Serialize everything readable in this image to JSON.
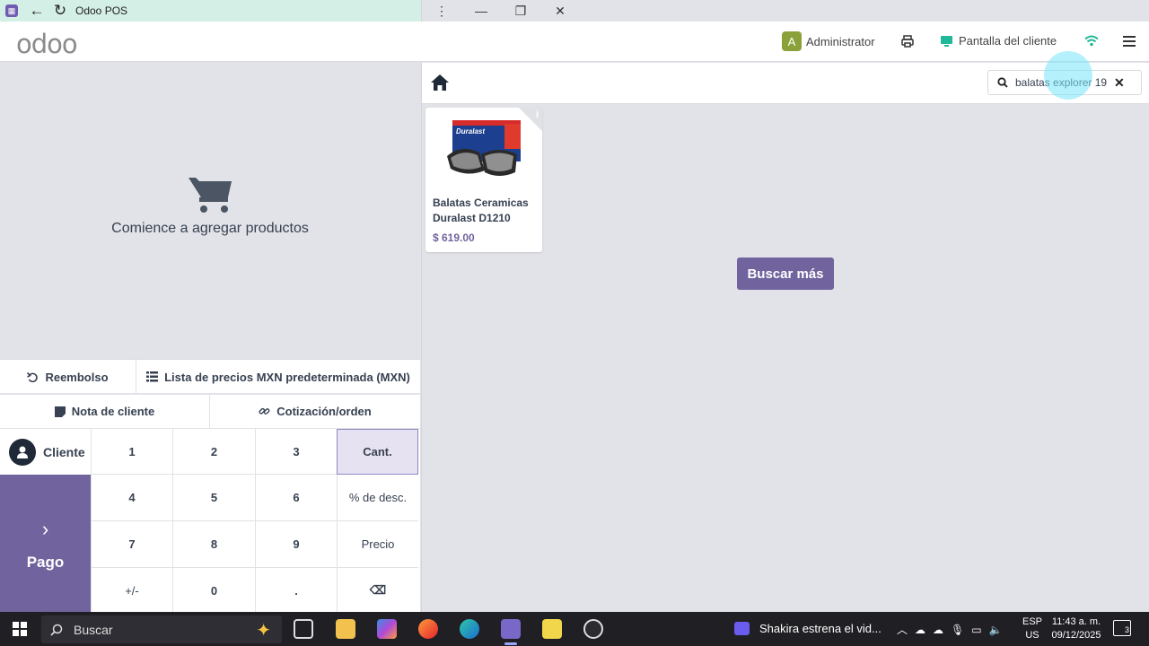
{
  "window": {
    "title": "Odoo POS",
    "back_glyph": "←",
    "reload_glyph": "↻",
    "kebab_glyph": "⋮",
    "minimize_glyph": "—",
    "restore_glyph": "❐",
    "close_glyph": "✕"
  },
  "header": {
    "logo": "odoo",
    "user_initial": "A",
    "user_name": "Administrator",
    "customer_display": "Pantalla del cliente",
    "colors": {
      "accent": "#71639e",
      "wifi": "#21b799",
      "display_icon": "#21b799"
    }
  },
  "cart": {
    "empty_message": "Comience a agregar productos"
  },
  "controls": {
    "refund": "Reembolso",
    "pricelist": "Lista de precios MXN predeterminada (MXN)",
    "customer_note": "Nota de cliente",
    "quotation": "Cotización/orden"
  },
  "customer_button": "Cliente",
  "pay_button": {
    "chevron": "›",
    "label": "Pago"
  },
  "numpad": {
    "keys": [
      "1",
      "2",
      "3",
      "Cant.",
      "4",
      "5",
      "6",
      "% de desc.",
      "7",
      "8",
      "9",
      "Precio",
      "+/-",
      "0",
      ".",
      "⌫"
    ],
    "active_mode": "Cant."
  },
  "search": {
    "value": "balatas explorer 19",
    "clear_glyph": "✕"
  },
  "products": [
    {
      "name": "Balatas Ceramicas Duralast D1210",
      "price": "$ 619.00",
      "brand_on_box": "Duralast",
      "info_glyph": "i"
    }
  ],
  "load_more": "Buscar más",
  "taskbar": {
    "search_placeholder": "Buscar",
    "news": "Shakira estrena el vid...",
    "lang_top": "ESP",
    "lang_bottom": "US",
    "time": "11:43 a. m.",
    "date": "09/12/2025",
    "notification_count": "3"
  }
}
